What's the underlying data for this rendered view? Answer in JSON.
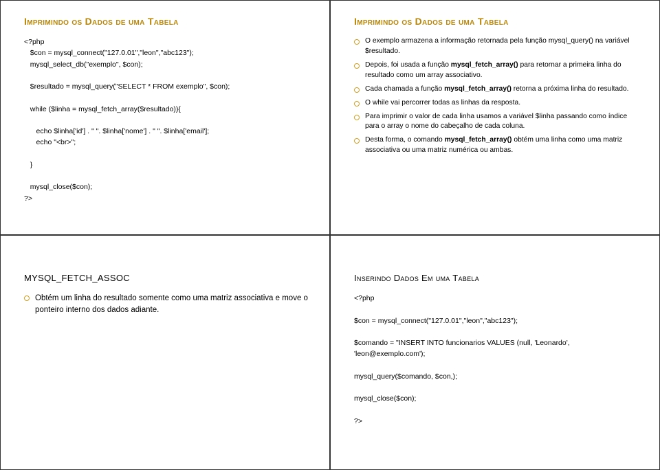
{
  "topLeft": {
    "title": "Imprimindo os Dados de uma Tabela",
    "code": "<?php\n   $con = mysql_connect(\"127.0.01\",\"leon\",\"abc123\");\n   mysql_select_db(\"exemplo\", $con);\n\n   $resultado = mysql_query(\"SELECT * FROM exemplo\", $con);\n\n   while ($linha = mysql_fetch_array($resultado)){\n\n      echo $linha['id'] . \" \". $linha['nome'] . \" \". $linha['email'];\n      echo \"<br>\";\n\n   }\n\n   mysql_close($con);\n?>"
  },
  "topRight": {
    "title": "Imprimindo os Dados de uma Tabela",
    "items": [
      "O exemplo armazena a informação retornada pela função mysql_query() na variável $resultado.",
      "Depois, foi usada a função mysql_fetch_array() para retornar a primeira linha do resultado como um array associativo.",
      "Cada chamada a função mysql_fetch_array() retorna a próxima linha do resultado.",
      "O while vai percorrer todas as linhas da resposta.",
      "Para imprimir o valor de cada linha usamos a variável $linha passando como índice para o  array o nome do cabeçalho de cada coluna.",
      "Desta forma, o comando mysql_fetch_array() obtém uma linha como uma matriz associativa ou uma matriz numérica ou ambas."
    ]
  },
  "bottomLeft": {
    "title": "MYSQL_FETCH_ASSOC",
    "items": [
      "Obtém um linha do resultado somente como uma matriz associativa e move o ponteiro interno dos dados adiante."
    ]
  },
  "bottomRight": {
    "title": "Inserindo Dados Em uma Tabela",
    "code": "<?php\n\n$con = mysql_connect(\"127.0.01\",\"leon\",\"abc123\");\n\n$comando = \"INSERT INTO funcionarios VALUES (null, 'Leonardo', 'leon@exemplo.com');\n\nmysql_query($comando, $con,);\n\nmysql_close($con);\n\n?>"
  }
}
